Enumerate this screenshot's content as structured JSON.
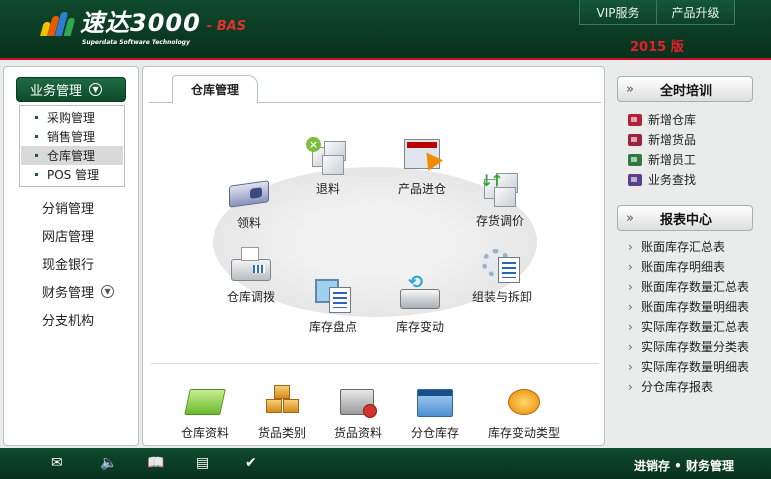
{
  "header": {
    "logo_text": "速达3000",
    "logo_suffix": "- BAS",
    "logo_subtitle": "Superdata Software Technology",
    "buttons": [
      "VIP服务",
      "产品升级"
    ],
    "edition_year": "2015 版"
  },
  "left_nav": {
    "module_button": "业务管理",
    "submenu": [
      {
        "label": "采购管理",
        "active": false
      },
      {
        "label": "销售管理",
        "active": false
      },
      {
        "label": "仓库管理",
        "active": true
      },
      {
        "label": "POS 管理",
        "active": false
      }
    ],
    "items": [
      "分销管理",
      "网店管理",
      "现金银行",
      "财务管理",
      "分支机构"
    ]
  },
  "main": {
    "tab": "仓库管理",
    "flow_items": [
      "退料",
      "产品进仓",
      "领料",
      "存货调价",
      "仓库调拨",
      "组装与拆卸",
      "库存盘点",
      "库存变动"
    ],
    "bottom_items": [
      "仓库资料",
      "货品类别",
      "货品资料",
      "分仓库存",
      "库存变动类型"
    ]
  },
  "right_panel": {
    "training_title": "全时培训",
    "training_items": [
      {
        "label": "新增仓库",
        "icon": "book-red-icon",
        "color": "#b0243b"
      },
      {
        "label": "新增货品",
        "icon": "book-red-icon",
        "color": "#9b2340"
      },
      {
        "label": "新增员工",
        "icon": "book-green-icon",
        "color": "#2f7a3d"
      },
      {
        "label": "业务查找",
        "icon": "book-purple-icon",
        "color": "#5a3f8a"
      }
    ],
    "report_title": "报表中心",
    "reports": [
      "账面库存汇总表",
      "账面库存明细表",
      "账面库存数量汇总表",
      "账面库存数量明细表",
      "实际库存数量汇总表",
      "实际库存数量分类表",
      "实际库存数量明细表",
      "分仓库存报表"
    ]
  },
  "footer": {
    "icons": [
      "mail-icon",
      "speaker-icon",
      "book-icon",
      "calendar-icon",
      "check-icon"
    ],
    "text": "进销存 • 财务管理"
  },
  "colors": {
    "brand_green": "#0b3a22",
    "accent_red": "#e3202c"
  }
}
